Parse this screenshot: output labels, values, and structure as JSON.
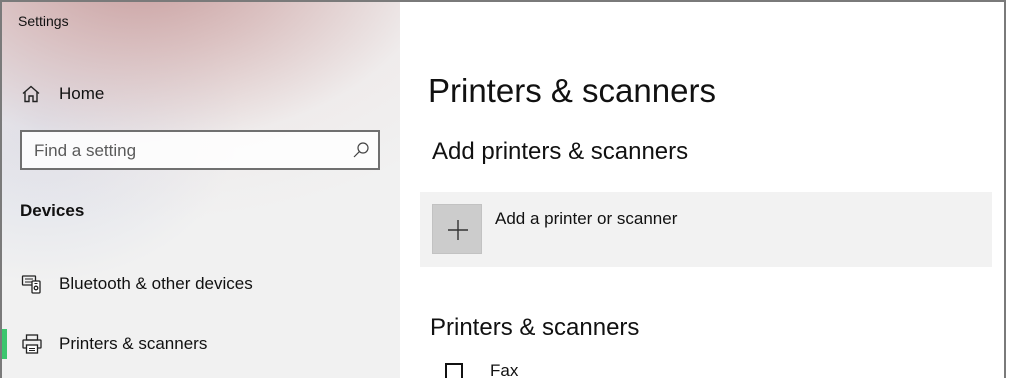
{
  "window": {
    "title": "Settings"
  },
  "sidebar": {
    "home": {
      "label": "Home",
      "icon": "home-icon"
    },
    "search": {
      "placeholder": "Find a setting",
      "value": "",
      "icon": "search-icon"
    },
    "section_heading": "Devices",
    "items": [
      {
        "label": "Bluetooth & other devices",
        "icon": "bluetooth-devices-icon",
        "active": false
      },
      {
        "label": "Printers & scanners",
        "icon": "printer-icon",
        "active": true
      }
    ],
    "active_indicator_color": "#3cc66e"
  },
  "main": {
    "title": "Printers & scanners",
    "add_section": {
      "heading": "Add printers & scanners",
      "button_label": "Add a printer or scanner",
      "button_icon": "plus-icon"
    },
    "list_section": {
      "heading": "Printers & scanners",
      "devices": [
        {
          "label": "Fax",
          "icon": "printer-icon"
        }
      ]
    }
  }
}
